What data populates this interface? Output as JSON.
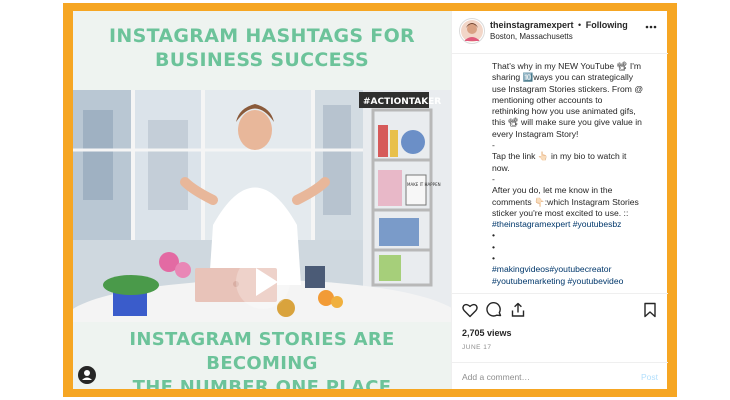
{
  "post": {
    "headline_top_1": "INSTAGRAM HASHTAGS FOR",
    "headline_top_2": "BUSINESS SUCCESS",
    "headline_bottom_1": "INSTAGRAM STORIES ARE BECOMING",
    "headline_bottom_2": "THE NUMBER ONE PLACE",
    "sign_text": "#ACTIONTAKER",
    "sign_mini": "MAKE IT HAPPEN"
  },
  "header": {
    "username": "theinstagramexpert",
    "separator": "•",
    "follow": "Following",
    "location": "Boston, Massachusetts"
  },
  "caption": {
    "l1": "That's why in my NEW YouTube 📽 I'm",
    "l2": "sharing 🔟ways you can strategically",
    "l3": "use Instagram Stories stickers. From @",
    "l4": "mentioning other accounts to",
    "l5": "rethinking how you use animated gifs,",
    "l6": "this 📽 will make sure you give value in",
    "l7": "every Instagram Story!",
    "l8": "-",
    "l9": "Tap the link 👆🏻 in my bio to watch it",
    "l10": "now.",
    "l11": "-",
    "l12": "After you do, let me know in the",
    "l13": "comments 👇🏻:which Instagram Stories",
    "l14": "sticker you're most excited to use. ::",
    "tags1": [
      "#theinstagramexpert",
      "#youtubesbz"
    ],
    "b1": "•",
    "b2": "•",
    "b3": "•",
    "tags2": [
      "#makingvideos",
      "#youtubecreator"
    ],
    "tags3": [
      "#youtubemarketing",
      "#youtubevideo"
    ]
  },
  "stats": {
    "views": "2,705 views",
    "date": "JUNE 17"
  },
  "comment": {
    "placeholder": "Add a comment…",
    "post_label": "Post"
  },
  "colors": {
    "frame": "#f6a623",
    "headline": "#6cc39a",
    "hashtag": "#00376b"
  },
  "icons": [
    "play-icon",
    "user-icon",
    "more-icon",
    "heart-icon",
    "comment-icon",
    "share-icon",
    "bookmark-icon"
  ]
}
